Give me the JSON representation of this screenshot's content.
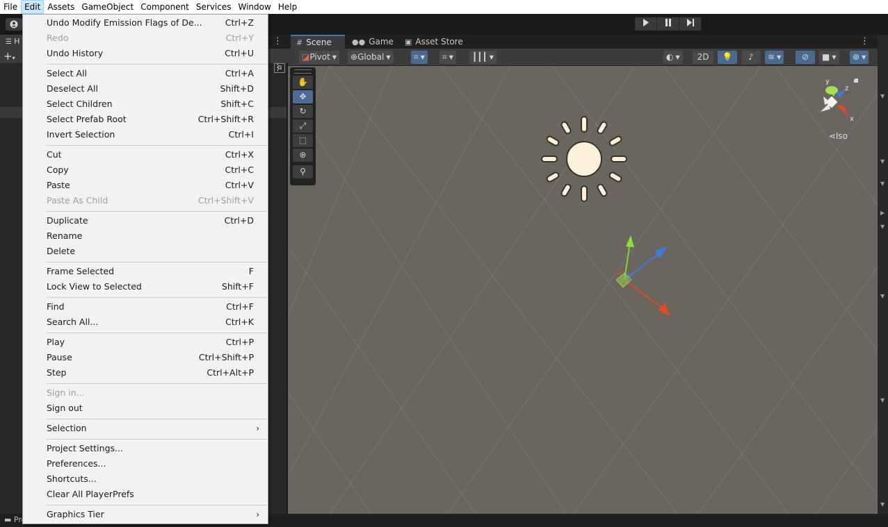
{
  "menubar": {
    "items": [
      "File",
      "Edit",
      "Assets",
      "GameObject",
      "Component",
      "Services",
      "Window",
      "Help"
    ],
    "active": "Edit"
  },
  "toolbar": {
    "account_icon": "account-icon",
    "play_icon": "play-icon",
    "pause_icon": "pause-icon",
    "step_icon": "step-icon"
  },
  "hierarchy": {
    "tab_label": "H",
    "add_label": "+"
  },
  "scene": {
    "tabs": [
      "Scene",
      "Game",
      "Asset Store"
    ],
    "active_tab": "Scene",
    "pivot_label": "Pivot",
    "global_label": "Global",
    "mode_2d_label": "2D",
    "iso_label": "Iso",
    "gizmo_axes": [
      "y",
      "z",
      "x"
    ]
  },
  "bottom": {
    "project_tab": "Project"
  },
  "edit_menu": {
    "items": [
      {
        "label": "Undo Modify Emission Flags of De...",
        "shortcut": "Ctrl+Z",
        "disabled": false
      },
      {
        "label": "Redo",
        "shortcut": "Ctrl+Y",
        "disabled": true
      },
      {
        "label": "Undo History",
        "shortcut": "Ctrl+U",
        "disabled": false
      },
      {
        "label": "Select All",
        "shortcut": "Ctrl+A",
        "disabled": false
      },
      {
        "label": "Deselect All",
        "shortcut": "Shift+D",
        "disabled": false
      },
      {
        "label": "Select Children",
        "shortcut": "Shift+C",
        "disabled": false
      },
      {
        "label": "Select Prefab Root",
        "shortcut": "Ctrl+Shift+R",
        "disabled": false
      },
      {
        "label": "Invert Selection",
        "shortcut": "Ctrl+I",
        "disabled": false
      },
      {
        "label": "Cut",
        "shortcut": "Ctrl+X",
        "disabled": false
      },
      {
        "label": "Copy",
        "shortcut": "Ctrl+C",
        "disabled": false
      },
      {
        "label": "Paste",
        "shortcut": "Ctrl+V",
        "disabled": false
      },
      {
        "label": "Paste As Child",
        "shortcut": "Ctrl+Shift+V",
        "disabled": true
      },
      {
        "label": "Duplicate",
        "shortcut": "Ctrl+D",
        "disabled": false
      },
      {
        "label": "Rename",
        "shortcut": "",
        "disabled": false
      },
      {
        "label": "Delete",
        "shortcut": "",
        "disabled": false
      },
      {
        "label": "Frame Selected",
        "shortcut": "F",
        "disabled": false
      },
      {
        "label": "Lock View to Selected",
        "shortcut": "Shift+F",
        "disabled": false
      },
      {
        "label": "Find",
        "shortcut": "Ctrl+F",
        "disabled": false
      },
      {
        "label": "Search All...",
        "shortcut": "Ctrl+K",
        "disabled": false
      },
      {
        "label": "Play",
        "shortcut": "Ctrl+P",
        "disabled": false
      },
      {
        "label": "Pause",
        "shortcut": "Ctrl+Shift+P",
        "disabled": false
      },
      {
        "label": "Step",
        "shortcut": "Ctrl+Alt+P",
        "disabled": false
      },
      {
        "label": "Sign in...",
        "shortcut": "",
        "disabled": true
      },
      {
        "label": "Sign out",
        "shortcut": "",
        "disabled": false
      },
      {
        "label": "Selection",
        "shortcut": "",
        "disabled": false,
        "submenu": true
      },
      {
        "label": "Project Settings...",
        "shortcut": "",
        "disabled": false
      },
      {
        "label": "Preferences...",
        "shortcut": "",
        "disabled": false
      },
      {
        "label": "Shortcuts...",
        "shortcut": "",
        "disabled": false
      },
      {
        "label": "Clear All PlayerPrefs",
        "shortcut": "",
        "disabled": false
      },
      {
        "label": "Graphics Tier",
        "shortcut": "",
        "disabled": false,
        "submenu": true
      }
    ],
    "submenu_arrow": "›"
  }
}
